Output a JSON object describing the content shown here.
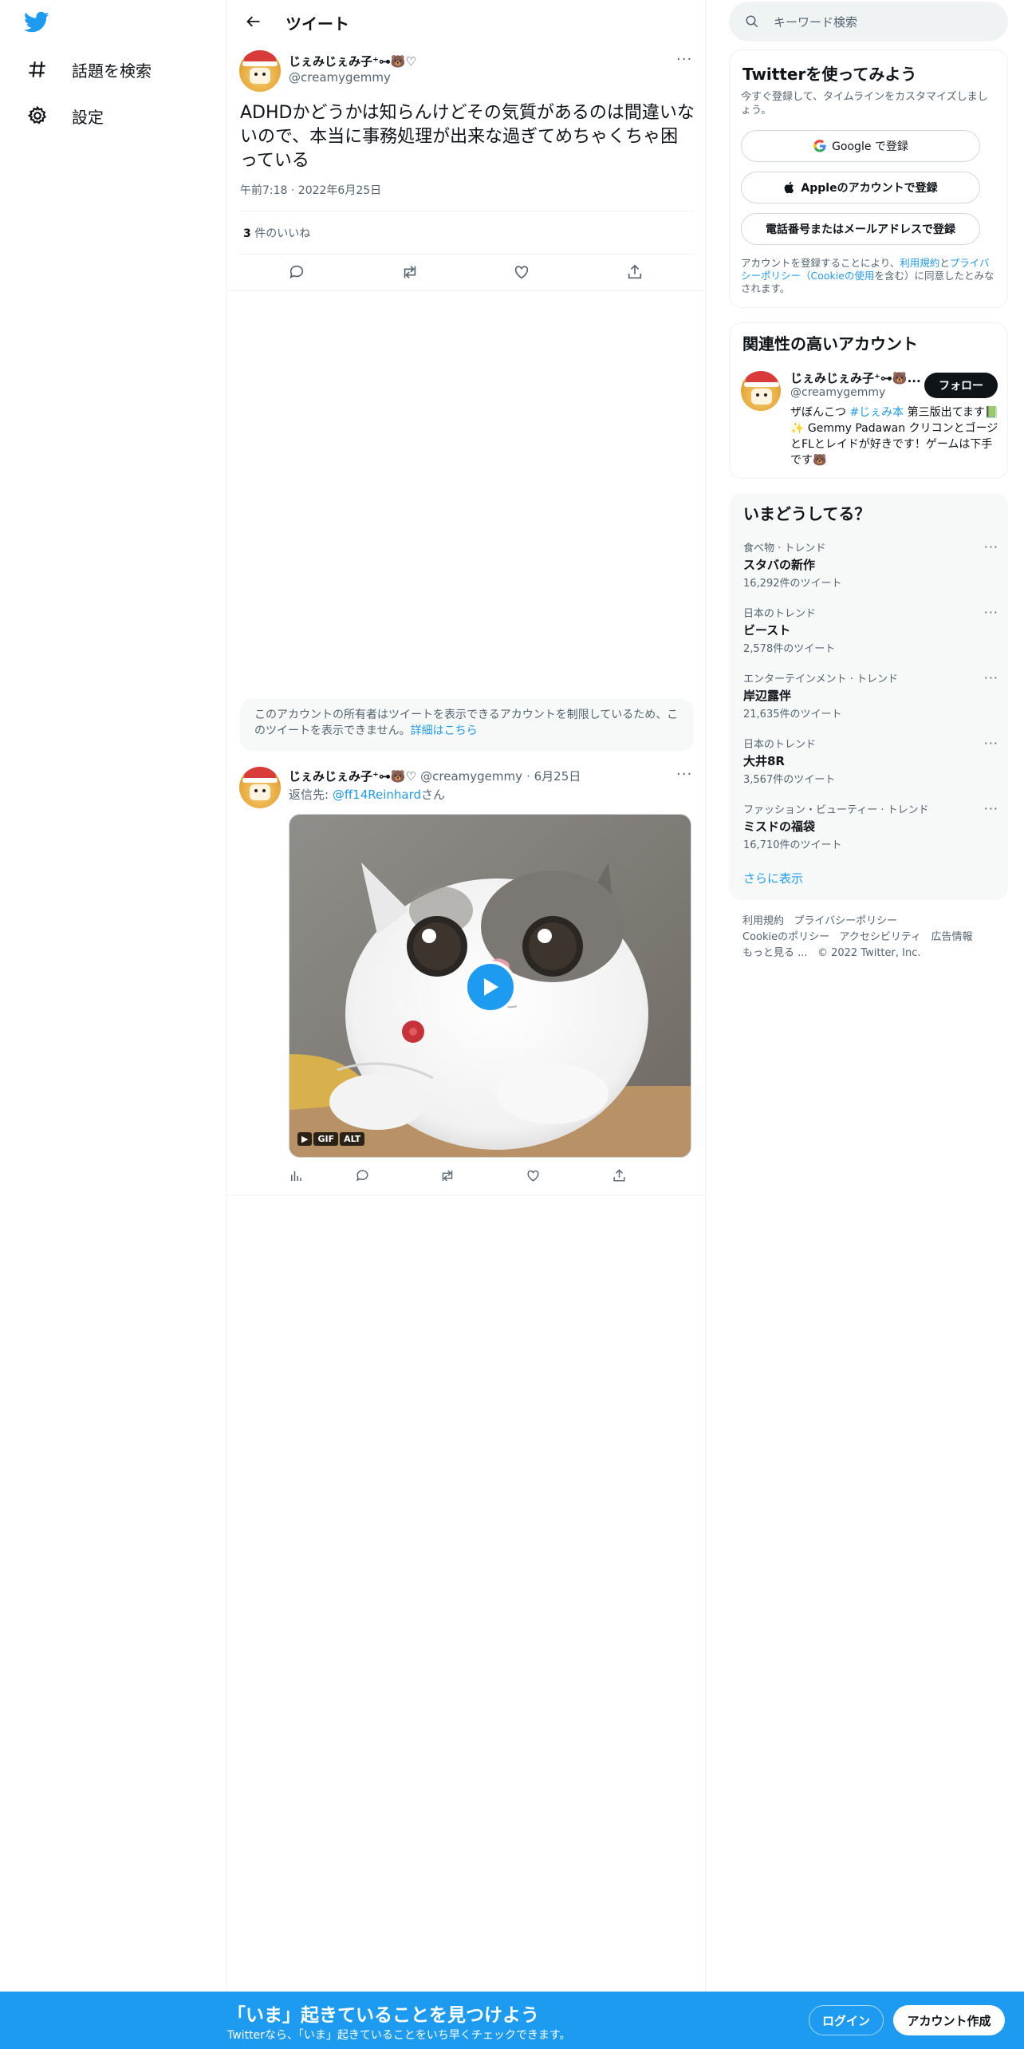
{
  "sidebar": {
    "explore_label": "話題を検索",
    "settings_label": "設定"
  },
  "header": {
    "title": "ツイート"
  },
  "tweet": {
    "display_name": "じぇみじぇみ子⁺⊶🐻♡",
    "handle": "@creamygemmy",
    "text": "ADHDかどうかは知らんけどその気質があるのは間違いないので、本当に事務処理が出来な過ぎてめちゃくちゃ困っている",
    "time": "午前7:18 · 2022年6月25日",
    "like_count": "3",
    "like_label": " 件のいいね"
  },
  "restricted": {
    "text": "このアカウントの所有者はツイートを表示できるアカウントを制限しているため、このツイートを表示できません。",
    "link": "詳細はこちら"
  },
  "reply": {
    "display_name": "じぇみじぇみ子⁺⊶🐻♡",
    "handle": "@creamygemmy",
    "date": "· 6月25日",
    "reply_prefix": "返信先: ",
    "reply_to": "@ff14Reinhard",
    "reply_suffix": "さん",
    "media_badges": [
      "GIF",
      "ALT"
    ]
  },
  "right": {
    "search_placeholder": "キーワード検索",
    "signup": {
      "title": "Twitterを使ってみよう",
      "subtitle": "今すぐ登録して、タイムラインをカスタマイズしましょう。",
      "google": "Google で登録",
      "apple": "Appleのアカウントで登録",
      "phone": "電話番号またはメールアドレスで登録",
      "terms_pre": "アカウントを登録することにより、",
      "terms_link1": "利用規約",
      "terms_mid": "と",
      "terms_link2": "プライバシーポリシー（Cookieの使用",
      "terms_post": "を含む）に同意したとみなされます。"
    },
    "related": {
      "title": "関連性の高いアカウント",
      "display_name": "じぇみじぇみ子⁺⊶🐻...",
      "handle": "@creamygemmy",
      "follow": "フォロー",
      "bio_pre": "ザぼんこつ ",
      "bio_tag": "#じぇみ本",
      "bio_post": " 第三版出てます📗✨ Gemmy Padawan クリコンとゴージとFLとレイドが好きです！ゲームは下手です🐻"
    },
    "trends": {
      "title": "いまどうしてる？",
      "items": [
        {
          "category": "食べ物 · トレンド",
          "topic": "スタバの新作",
          "count": "16,292件のツイート"
        },
        {
          "category": "日本のトレンド",
          "topic": "ビースト",
          "count": "2,578件のツイート"
        },
        {
          "category": "エンターテインメント · トレンド",
          "topic": "岸辺露伴",
          "count": "21,635件のツイート"
        },
        {
          "category": "日本のトレンド",
          "topic": "大井8R",
          "count": "3,567件のツイート"
        },
        {
          "category": "ファッション・ビューティー · トレンド",
          "topic": "ミスドの福袋",
          "count": "16,710件のツイート"
        }
      ],
      "show_more": "さらに表示"
    },
    "footer": {
      "terms": "利用規約",
      "privacy": "プライバシーポリシー",
      "cookie": "Cookieのポリシー",
      "accessibility": "アクセシビリティ",
      "ads": "広告情報",
      "more": "もっと見る ...",
      "copyright": "© 2022 Twitter, Inc."
    }
  },
  "banner": {
    "title": "「いま」起きていることを見つけよう",
    "subtitle": "Twitterなら、「いま」起きていることをいち早くチェックできます。",
    "login": "ログイン",
    "signup": "アカウント作成"
  },
  "colors": {
    "accent": "#1d9bf0",
    "text": "#0f1419",
    "muted": "#536471"
  }
}
